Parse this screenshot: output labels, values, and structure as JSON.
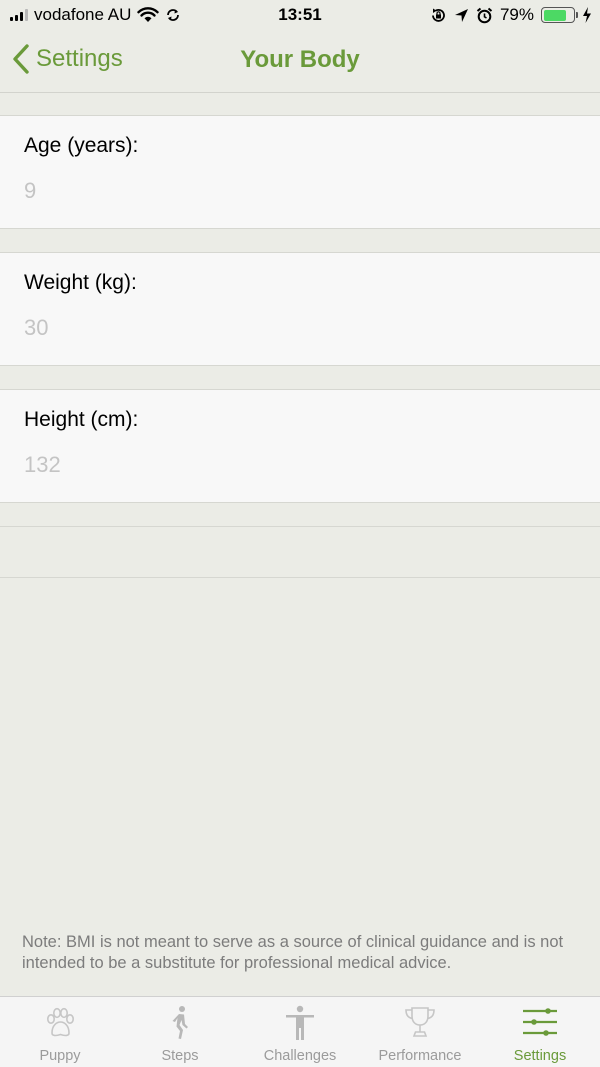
{
  "status_bar": {
    "carrier": "vodafone AU",
    "time": "13:51",
    "battery_percent": "79%",
    "battery_level": 0.79
  },
  "nav": {
    "back_label": "Settings",
    "title": "Your Body"
  },
  "fields": [
    {
      "label": "Age (years):",
      "value": "9"
    },
    {
      "label": "Weight (kg):",
      "value": "30"
    },
    {
      "label": "Height (cm):",
      "value": "132"
    }
  ],
  "note": "Note: BMI is not meant to serve as a source of clinical guidance and is not intended to be a substitute for professional medical advice.",
  "tabs": [
    {
      "label": "Puppy",
      "icon": "paw-icon"
    },
    {
      "label": "Steps",
      "icon": "walking-icon"
    },
    {
      "label": "Challenges",
      "icon": "person-icon"
    },
    {
      "label": "Performance",
      "icon": "trophy-icon"
    },
    {
      "label": "Settings",
      "icon": "sliders-icon",
      "active": true
    }
  ],
  "colors": {
    "accent": "#6a9a3a",
    "background": "#ebece6",
    "cell": "#f8f8f8",
    "value_text": "#c4c4c4",
    "battery": "#4cd964"
  }
}
